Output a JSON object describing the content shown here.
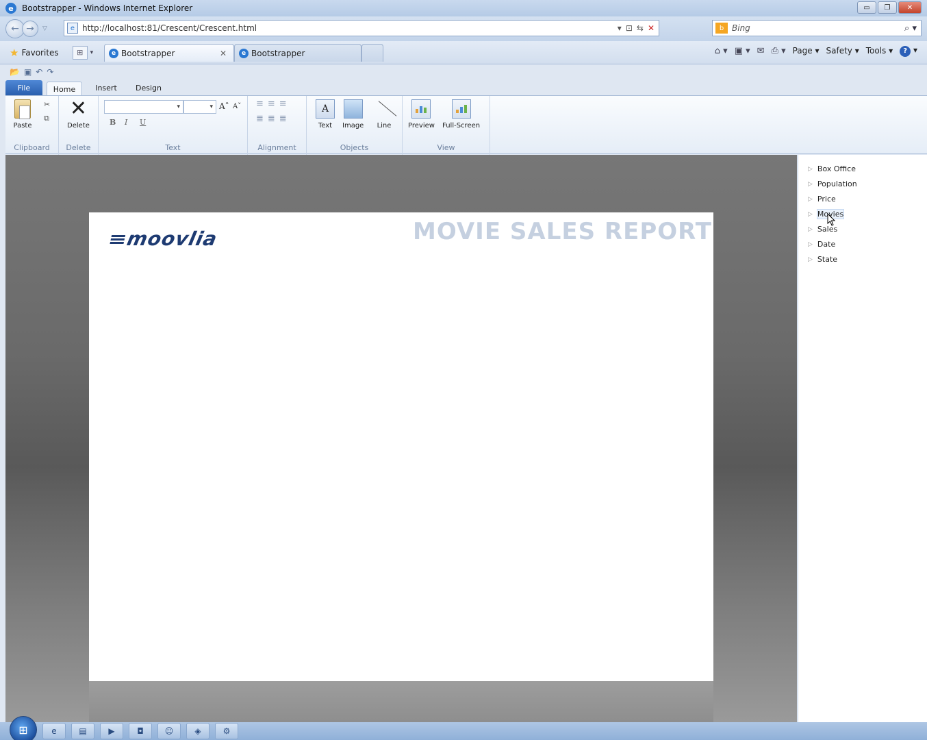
{
  "window": {
    "title": "Bootstrapper - Windows Internet Explorer",
    "controls": [
      "minimize",
      "restore",
      "close"
    ]
  },
  "address_bar": {
    "url": "http://localhost:81/Crescent/Crescent.html",
    "search_placeholder": "Bing"
  },
  "favorites_bar": {
    "favorites_label": "Favorites",
    "tabs": [
      {
        "label": "Bootstrapper",
        "active": true
      },
      {
        "label": "Bootstrapper",
        "active": false
      }
    ],
    "commands": {
      "page": "Page",
      "safety": "Safety",
      "tools": "Tools"
    }
  },
  "ribbon": {
    "tabs": [
      "File",
      "Home",
      "Insert",
      "Design"
    ],
    "active_tab": "Home",
    "groups": {
      "clipboard": {
        "label": "Clipboard",
        "paste": "Paste"
      },
      "delete": {
        "label": "Delete",
        "delete": "Delete"
      },
      "text": {
        "label": "Text",
        "bold": "B",
        "italic": "I",
        "underline": "U",
        "grow": "A",
        "shrink": "A"
      },
      "alignment": {
        "label": "Alignment"
      },
      "objects": {
        "label": "Objects",
        "text": "Text",
        "image": "Image",
        "line": "Line"
      },
      "view": {
        "label": "View",
        "preview": "Preview",
        "fullscreen": "Full-Screen"
      }
    }
  },
  "report": {
    "logo_text": "moovlia",
    "title": "MOVIE SALES REPORT"
  },
  "field_list": {
    "items": [
      "Box Office",
      "Population",
      "Price",
      "Movies",
      "Sales",
      "Date",
      "State"
    ],
    "hovered": "Movies"
  },
  "colors": {
    "ribbon_file_tab": "#2a5fae",
    "report_title": "#c5d0e0",
    "logo": "#1e3b72"
  }
}
